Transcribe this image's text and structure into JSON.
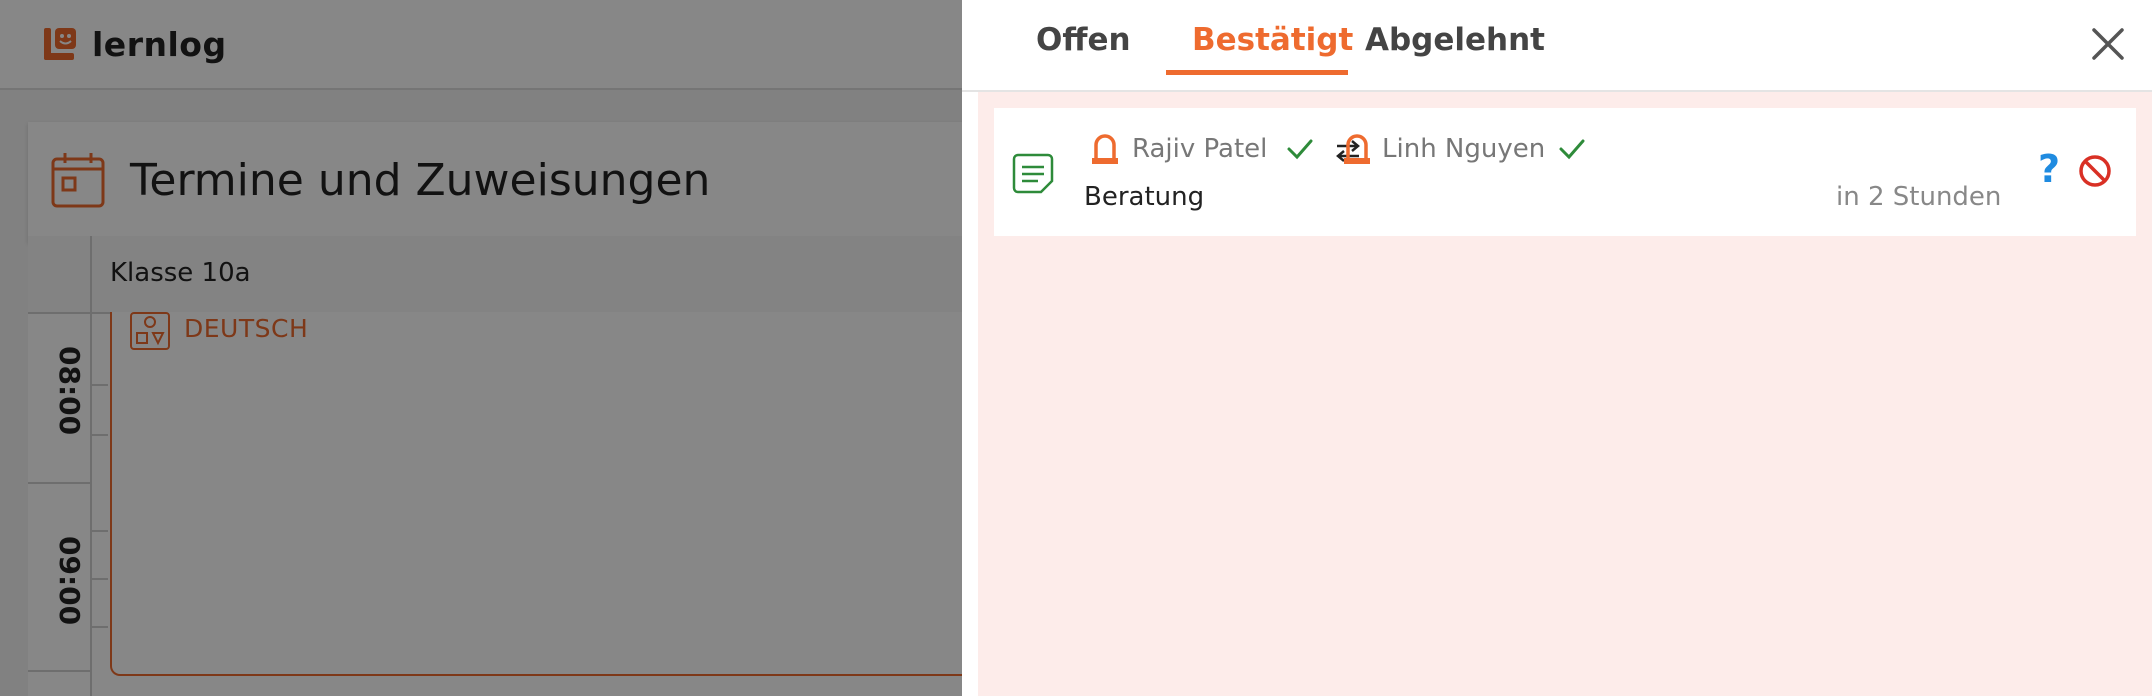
{
  "app": {
    "logo_text": "lernlog",
    "page_title": "Termine und Zuweisungen",
    "class_label": "Klasse 10a",
    "hours": [
      "08:00",
      "09:00"
    ],
    "event_label": "DEUTSCH"
  },
  "panel": {
    "tabs": [
      {
        "label": "Offen",
        "active": false
      },
      {
        "label": "Bestätigt",
        "active": true
      },
      {
        "label": "Abgelehnt",
        "active": false
      }
    ],
    "items": [
      {
        "from_name": "Rajiv Patel",
        "to_name": "Linh Nguyen",
        "title": "Beratung",
        "time": "in 2 Stunden",
        "help_label": "?"
      }
    ]
  },
  "colors": {
    "accent": "#ee6b2f",
    "confirm_green": "#2e8b3a",
    "help_blue": "#1f8be0",
    "decline_red": "#d93025",
    "list_background": "#fdecea"
  },
  "icons": {
    "logo": "lernlog-logo-icon",
    "calendar": "calendar-icon",
    "event": "subject-shapes-icon",
    "item": "note-icon",
    "person": "person-icon",
    "confirmed": "check-icon",
    "swap": "swap-arrows-icon",
    "help": "question-icon",
    "decline": "prohibit-icon",
    "close": "close-icon"
  }
}
